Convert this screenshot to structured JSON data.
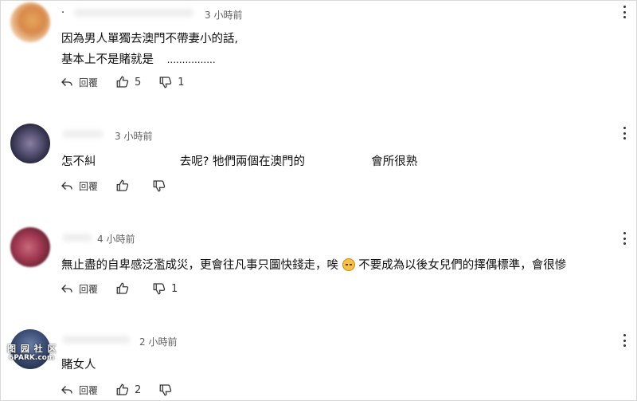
{
  "comments": [
    {
      "handle": ".",
      "time": "3 小時前",
      "lines": [
        "因為男人單獨去澳門不帶妻小的話,",
        "基本上不是賭就是",
        "................"
      ],
      "reply_label": "回覆",
      "likes": "5",
      "dislikes": "1"
    },
    {
      "handle": "",
      "time": "3 小時前",
      "text_parts": [
        "怎不糾",
        "去呢? 牠們兩個在澳門的",
        "會所很熟"
      ],
      "reply_label": "回覆",
      "likes": "",
      "dislikes": ""
    },
    {
      "handle": "",
      "time": "4 小時前",
      "text_before": "無止盡的自卑感泛濫成災，更會往凡事只圖快錢走，唉",
      "text_after": "不要成為以後女兒們的擇偶標準，會很慘",
      "reply_label": "回覆",
      "likes": "",
      "dislikes": "1"
    },
    {
      "handle": "",
      "time": "2 小時前",
      "text": "賭女人",
      "reply_label": "回覆",
      "likes": "2",
      "dislikes": ""
    }
  ],
  "watermark": {
    "line1": "图 园 社 区",
    "line2": "6PARK.com"
  },
  "icons": {
    "reply": "reply-arrow-icon",
    "like": "thumbs-up-icon",
    "dislike": "thumbs-down-icon",
    "menu": "kebab-menu-icon",
    "emoji": "disappointed-face-icon"
  }
}
